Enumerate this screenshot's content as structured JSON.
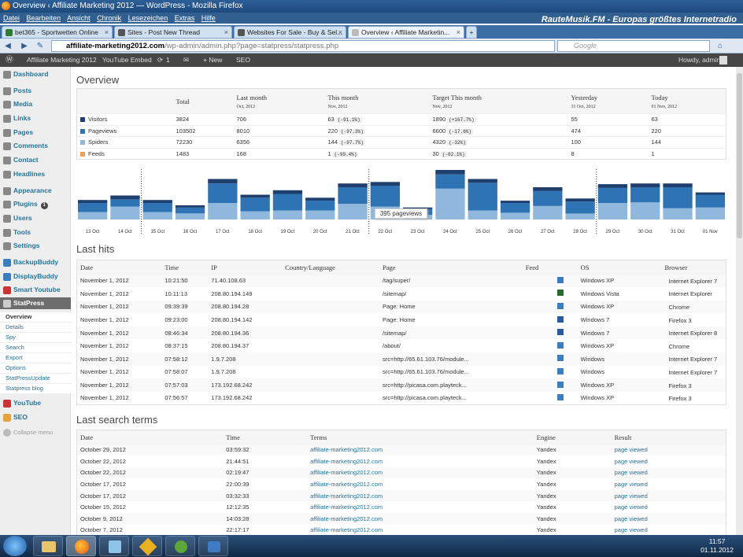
{
  "browser": {
    "window_title": "Overview ‹ Affiliate Marketing 2012 — WordPress - Mozilla Firefox",
    "menu": [
      "Datei",
      "Bearbeiten",
      "Ansicht",
      "Chronik",
      "Lesezeichen",
      "Extras",
      "Hilfe"
    ],
    "radio_text": "RauteMusik.FM - Europas größtes Internetradio",
    "tabs": [
      "bet365 - Sportwetten Online",
      "Sites - Post New Thread",
      "Websites For Sale - Buy & Sel...",
      "Overview ‹ Affiliate Marketin..."
    ],
    "url_domain": "affiliate-marketing2012.com",
    "url_path": "/wp-admin/admin.php?page=statpress/statpress.php",
    "search_placeholder": "Google",
    "new_tab": "+"
  },
  "adminbar": {
    "site": "Affiliate Marketing 2012",
    "youtube": "YouTube Embed",
    "updates": "1",
    "new": "+ New",
    "seo": "SEO",
    "howdy": "Howdy, admin"
  },
  "sidebar": {
    "items": [
      "Dashboard",
      "Posts",
      "Media",
      "Links",
      "Pages",
      "Comments",
      "Contact",
      "Headlines",
      "Appearance",
      "Plugins",
      "Users",
      "Tools",
      "Settings",
      "BackupBuddy",
      "DisplayBuddy",
      "Smart Youtube",
      "StatPress"
    ],
    "plugins_badge": "1",
    "sub": [
      "Overview",
      "Details",
      "Spy",
      "Search",
      "Export",
      "Options",
      "StatPressUpdate",
      "Statpress blog"
    ],
    "after": [
      "YouTube",
      "SEO"
    ],
    "collapse": "Collapse menu"
  },
  "overview": {
    "title": "Overview",
    "headers": [
      "Total",
      "Last month",
      "This month",
      "Target This month",
      "Yesterday",
      "Today"
    ],
    "subheaders": [
      "",
      "Oct, 2012",
      "Nov, 2012",
      "Nov, 2012",
      "31 Oct, 2012",
      "01 Nov, 2012"
    ],
    "rows": [
      {
        "label": "Visitors",
        "color": "#1f3f6f",
        "total": "3824",
        "last": "706",
        "this": "63",
        "this_cmp": "(-91.1%)",
        "target": "1890",
        "target_cmp": "(+167.7%)",
        "yest": "55",
        "today": "63"
      },
      {
        "label": "Pageviews",
        "color": "#2e74b5",
        "total": "103502",
        "last": "8010",
        "this": "220",
        "this_cmp": "(-97.3%)",
        "target": "6600",
        "target_cmp": "(-17.6%)",
        "yest": "474",
        "today": "220"
      },
      {
        "label": "Spiders",
        "color": "#8fb8dc",
        "total": "72230",
        "last": "6356",
        "this": "144",
        "this_cmp": "(-97.7%)",
        "target": "4320",
        "target_cmp": "(-32%)",
        "yest": "100",
        "today": "144"
      },
      {
        "label": "Feeds",
        "color": "#f0a050",
        "total": "1483",
        "last": "168",
        "this": "1",
        "this_cmp": "(-99.4%)",
        "target": "30",
        "target_cmp": "(-82.1%)",
        "yest": "8",
        "today": "1"
      }
    ]
  },
  "chart_data": {
    "type": "bar",
    "categories": [
      "13 Oct",
      "14 Oct",
      "15 Oct",
      "16 Oct",
      "17 Oct",
      "18 Oct",
      "19 Oct",
      "20 Oct",
      "21 Oct",
      "22 Oct",
      "23 Oct",
      "24 Oct",
      "25 Oct",
      "26 Oct",
      "27 Oct",
      "28 Oct",
      "29 Oct",
      "30 Oct",
      "31 Oct",
      "01 Nov"
    ],
    "series": [
      {
        "name": "Visitors",
        "values": [
          4,
          5,
          4,
          3,
          6,
          4,
          5,
          4,
          5,
          5,
          2,
          6,
          5,
          3,
          5,
          4,
          5,
          5,
          5,
          3
        ]
      },
      {
        "name": "Pageviews",
        "values": [
          12,
          10,
          12,
          8,
          26,
          18,
          22,
          13,
          22,
          28,
          8,
          19,
          37,
          13,
          20,
          16,
          20,
          20,
          28,
          17
        ]
      },
      {
        "name": "Spiders",
        "values": [
          10,
          17,
          10,
          8,
          22,
          11,
          12,
          12,
          21,
          17,
          6,
          41,
          12,
          9,
          18,
          8,
          22,
          23,
          15,
          16
        ]
      }
    ],
    "tooltip": "395 pageviews",
    "ylim": [
      0,
      66
    ]
  },
  "last_hits": {
    "title": "Last hits",
    "headers": [
      "Date",
      "Time",
      "IP",
      "Country/Language",
      "Page",
      "Feed",
      "OS",
      "Browser"
    ],
    "rows": [
      [
        "November 1, 2012",
        "10:21:50",
        "71.40.108.63",
        "",
        "/tag/super/",
        "",
        "Windows XP",
        "Internet Explorer 7"
      ],
      [
        "November 1, 2012",
        "10:11:13",
        "208.80.194.149",
        "",
        "/sitemap/",
        "",
        "Windows Vista",
        "Internet Explorer"
      ],
      [
        "November 1, 2012",
        "09:39:39",
        "208.80.194.28",
        "",
        "Page: Home",
        "",
        "Windows XP",
        "Chrome"
      ],
      [
        "November 1, 2012",
        "09:23:00",
        "208.80.194.142",
        "",
        "Page: Home",
        "",
        "Windows 7",
        "Firefox 3"
      ],
      [
        "November 1, 2012",
        "08:46:34",
        "208.80.194.36",
        "",
        "/sitemap/",
        "",
        "Windows 7",
        "Internet Explorer 8"
      ],
      [
        "November 1, 2012",
        "08:37:15",
        "208.80.194.37",
        "",
        "/about/",
        "",
        "Windows XP",
        "Chrome"
      ],
      [
        "November 1, 2012",
        "07:58:12",
        "1.9.7.208",
        "",
        "src=http://65.61.103.76/module...",
        "",
        "Windows",
        "Internet Explorer 7"
      ],
      [
        "November 1, 2012",
        "07:58:07",
        "1.9.7.208",
        "",
        "src=http://65.61.103.76/module...",
        "",
        "Windows",
        "Internet Explorer 7"
      ],
      [
        "November 1, 2012",
        "07:57:03",
        "173.192.68.242",
        "",
        "src=http://picasa.com.playteck...",
        "",
        "Windows XP",
        "Firefox 3"
      ],
      [
        "November 1, 2012",
        "07:56:57",
        "173.192.68.242",
        "",
        "src=http://picasa.com.playteck...",
        "",
        "Windows XP",
        "Firefox 3"
      ]
    ]
  },
  "search_terms": {
    "title": "Last search terms",
    "headers": [
      "Date",
      "Time",
      "Terms",
      "Engine",
      "Result"
    ],
    "rows": [
      [
        "October 29, 2012",
        "03:59:32",
        "affiliate-marketing2012.com",
        "Yandex",
        "page viewed"
      ],
      [
        "October 22, 2012",
        "21:44:51",
        "affiliate-marketing2012.com",
        "Yandex",
        "page viewed"
      ],
      [
        "October 22, 2012",
        "02:19:47",
        "affiliate-marketing2012.com",
        "Yandex",
        "page viewed"
      ],
      [
        "October 17, 2012",
        "22:00:39",
        "affiliate-marketing2012.com",
        "Yandex",
        "page viewed"
      ],
      [
        "October 17, 2012",
        "03:32:33",
        "affiliate-marketing2012.com",
        "Yandex",
        "page viewed"
      ],
      [
        "October 15, 2012",
        "12:12:35",
        "affiliate-marketing2012.com",
        "Yandex",
        "page viewed"
      ],
      [
        "October 9, 2012",
        "14:03:28",
        "affiliate-marketing2012.com",
        "Yandex",
        "page viewed"
      ],
      [
        "October 7, 2012",
        "22:17:17",
        "affiliate-marketing2012.com",
        "Yandex",
        "page viewed"
      ]
    ]
  },
  "taskbar": {
    "time": "11:57",
    "date": "01.11.2012"
  }
}
